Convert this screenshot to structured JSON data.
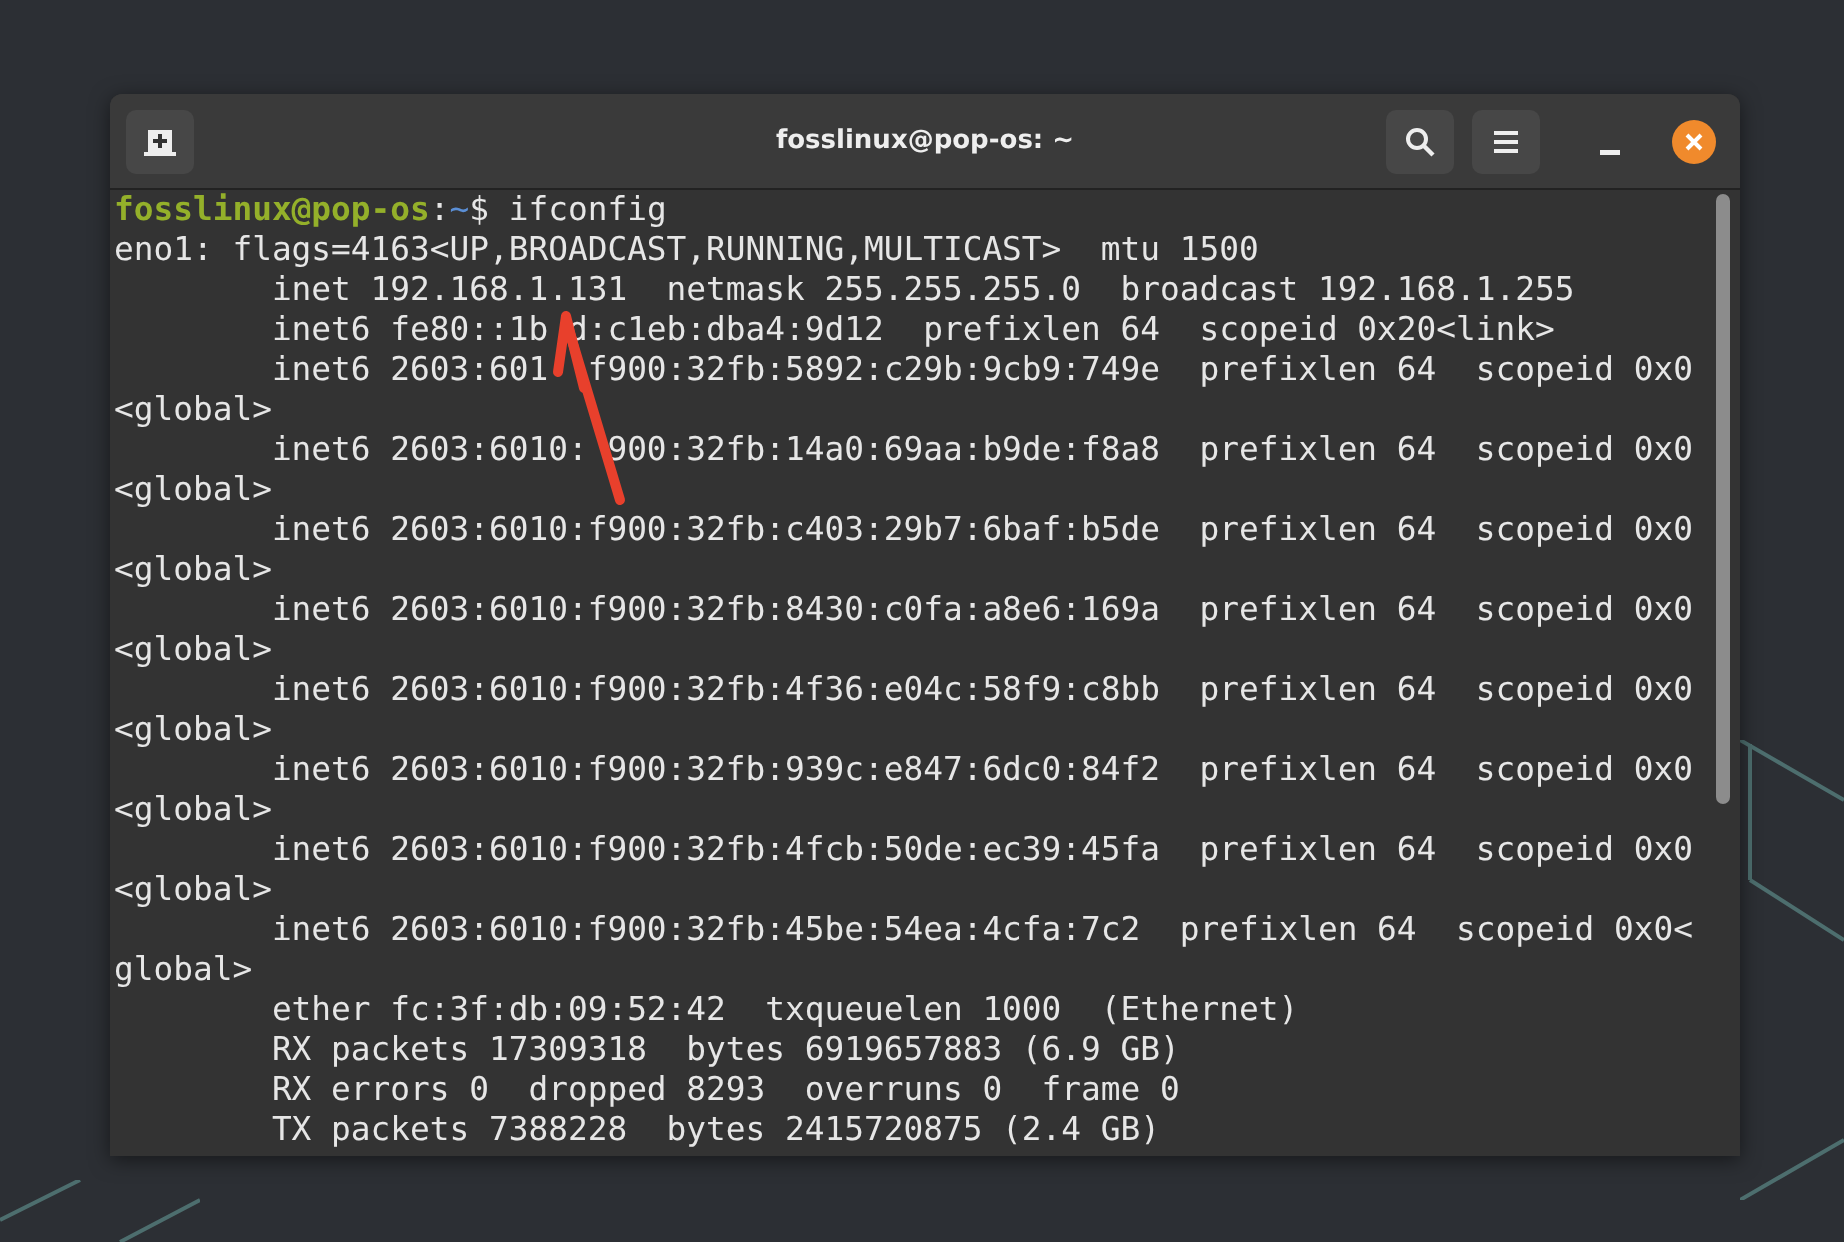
{
  "window": {
    "title": "fosslinux@pop-os: ~"
  },
  "terminal": {
    "prompt": {
      "user_host": "fosslinux@pop-os",
      "separator": ":",
      "path": "~",
      "symbol": "$",
      "command": "ifconfig"
    },
    "lines": [
      "eno1: flags=4163<UP,BROADCAST,RUNNING,MULTICAST>  mtu 1500",
      "        inet 192.168.1.131  netmask 255.255.255.0  broadcast 192.168.1.255",
      "        inet6 fe80::1b d:c1eb:dba4:9d12  prefixlen 64  scopeid 0x20<link>",
      "        inet6 2603:601  f900:32fb:5892:c29b:9cb9:749e  prefixlen 64  scopeid 0x0",
      "<global>",
      "        inet6 2603:6010: 900:32fb:14a0:69aa:b9de:f8a8  prefixlen 64  scopeid 0x0",
      "<global>",
      "        inet6 2603:6010:f900:32fb:c403:29b7:6baf:b5de  prefixlen 64  scopeid 0x0",
      "<global>",
      "        inet6 2603:6010:f900:32fb:8430:c0fa:a8e6:169a  prefixlen 64  scopeid 0x0",
      "<global>",
      "        inet6 2603:6010:f900:32fb:4f36:e04c:58f9:c8bb  prefixlen 64  scopeid 0x0",
      "<global>",
      "        inet6 2603:6010:f900:32fb:939c:e847:6dc0:84f2  prefixlen 64  scopeid 0x0",
      "<global>",
      "        inet6 2603:6010:f900:32fb:4fcb:50de:ec39:45fa  prefixlen 64  scopeid 0x0",
      "<global>",
      "        inet6 2603:6010:f900:32fb:45be:54ea:4cfa:7c2  prefixlen 64  scopeid 0x0<",
      "global>",
      "        ether fc:3f:db:09:52:42  txqueuelen 1000  (Ethernet)",
      "        RX packets 17309318  bytes 6919657883 (6.9 GB)",
      "        RX errors 0  dropped 8293  overruns 0  frame 0",
      "        TX packets 7388228  bytes 2415720875 (2.4 GB)"
    ]
  }
}
